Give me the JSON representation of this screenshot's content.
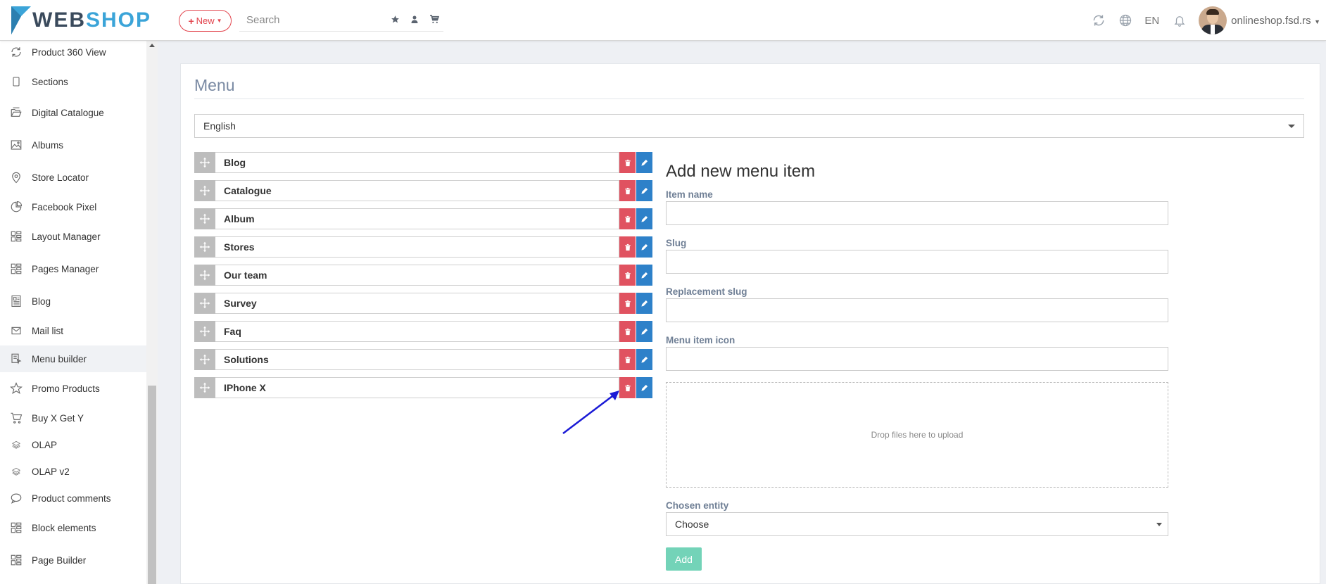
{
  "app": {
    "logo_part1": "WEB",
    "logo_part2": "SHOP"
  },
  "topbar": {
    "new_label": "New",
    "search_placeholder": "Search",
    "language": "EN",
    "account": "onlineshop.fsd.rs",
    "icons": [
      "star-icon",
      "user-icon",
      "cart-icon",
      "refresh-icon",
      "globe-icon",
      "bell-icon"
    ]
  },
  "sidebar": {
    "items": [
      {
        "label": "Product 360 View",
        "icon": "rotate-icon"
      },
      {
        "label": "Sections",
        "icon": "tablet-icon"
      },
      {
        "label": "Digital Catalogue",
        "icon": "folder-open-icon"
      },
      {
        "label": "Albums",
        "icon": "image-icon"
      },
      {
        "label": "Store Locator",
        "icon": "map-pin-icon"
      },
      {
        "label": "Facebook Pixel",
        "icon": "pie-chart-icon"
      },
      {
        "label": "Layout Manager",
        "icon": "layout-icon"
      },
      {
        "label": "Pages Manager",
        "icon": "layout-icon"
      },
      {
        "label": "Blog",
        "icon": "newspaper-icon"
      },
      {
        "label": "Mail list",
        "icon": "mail-icon"
      },
      {
        "label": "Menu builder",
        "icon": "menu-builder-icon",
        "active": true
      },
      {
        "label": "Promo Products",
        "icon": "star-outline-icon"
      },
      {
        "label": "Buy X Get Y",
        "icon": "cart-outline-icon"
      },
      {
        "label": "OLAP",
        "icon": "layers-icon"
      },
      {
        "label": "OLAP v2",
        "icon": "layers-icon"
      },
      {
        "label": "Product comments",
        "icon": "comment-icon"
      },
      {
        "label": "Block elements",
        "icon": "layout-icon"
      },
      {
        "label": "Page Builder",
        "icon": "layout-icon"
      }
    ]
  },
  "main": {
    "title": "Menu",
    "language_select": "English",
    "menu_items": [
      "Blog",
      "Catalogue",
      "Album",
      "Stores",
      "Our team",
      "Survey",
      "Faq",
      "Solutions",
      "IPhone X"
    ]
  },
  "form": {
    "title": "Add new menu item",
    "item_name_label": "Item name",
    "slug_label": "Slug",
    "replacement_slug_label": "Replacement slug",
    "menu_item_icon_label": "Menu item icon",
    "dropzone_text": "Drop files here to upload",
    "chosen_entity_label": "Chosen entity",
    "chosen_entity_value": "Choose",
    "add_label": "Add"
  },
  "colors": {
    "accent_blue": "#2e81c9",
    "danger_red": "#e05260",
    "add_green": "#73d3b8",
    "new_red": "#e2434c",
    "annotation_arrow": "#1a1ad6"
  }
}
